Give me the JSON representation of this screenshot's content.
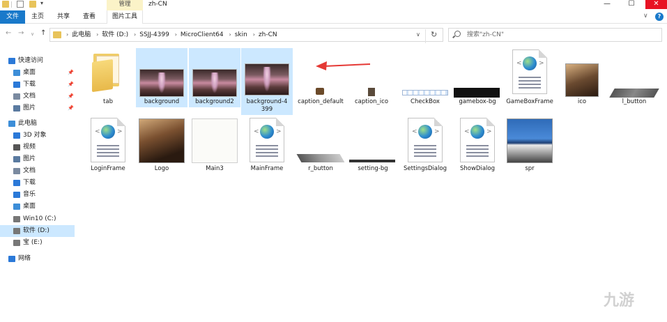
{
  "window": {
    "title": "zh-CN",
    "manage_tab": "管理",
    "minimize": "—",
    "maximize": "☐",
    "close": "✕"
  },
  "ribbon": {
    "tabs": [
      "文件",
      "主页",
      "共享",
      "查看",
      "图片工具"
    ],
    "expand": "∨",
    "help": "?"
  },
  "address": {
    "breadcrumbs": [
      "此电脑",
      "软件 (D:)",
      "SSJJ-4399",
      "MicroClient64",
      "skin",
      "zh-CN"
    ],
    "search_placeholder": "搜索\"zh-CN\""
  },
  "sidebar": {
    "items": [
      {
        "label": "快速访问",
        "icon": "star-icon",
        "color": "#2b79d8",
        "indent": 0
      },
      {
        "label": "桌面",
        "icon": "desktop-icon",
        "color": "#3d8ed8",
        "indent": 1,
        "pinned": true
      },
      {
        "label": "下载",
        "icon": "download-icon",
        "color": "#2b79d8",
        "indent": 1,
        "pinned": true
      },
      {
        "label": "文档",
        "icon": "documents-icon",
        "color": "#7a8aa0",
        "indent": 1,
        "pinned": true
      },
      {
        "label": "图片",
        "icon": "pictures-icon",
        "color": "#5a7aa0",
        "indent": 1,
        "pinned": true
      },
      {
        "label": "此电脑",
        "icon": "computer-icon",
        "color": "#3d8ed8",
        "indent": 0
      },
      {
        "label": "3D 对象",
        "icon": "3d-objects-icon",
        "color": "#2b79d8",
        "indent": 1
      },
      {
        "label": "视频",
        "icon": "videos-icon",
        "color": "#555",
        "indent": 1
      },
      {
        "label": "图片",
        "icon": "pictures-icon",
        "color": "#5a7aa0",
        "indent": 1
      },
      {
        "label": "文档",
        "icon": "documents-icon",
        "color": "#7a8aa0",
        "indent": 1
      },
      {
        "label": "下载",
        "icon": "download-icon",
        "color": "#2b79d8",
        "indent": 1
      },
      {
        "label": "音乐",
        "icon": "music-icon",
        "color": "#2b79d8",
        "indent": 1
      },
      {
        "label": "桌面",
        "icon": "desktop-icon",
        "color": "#3d8ed8",
        "indent": 1
      },
      {
        "label": "Win10 (C:)",
        "icon": "drive-icon",
        "color": "#777",
        "indent": 1
      },
      {
        "label": "软件 (D:)",
        "icon": "drive-icon",
        "color": "#777",
        "indent": 1,
        "selected": true
      },
      {
        "label": "宝 (E:)",
        "icon": "drive-icon",
        "color": "#777",
        "indent": 1
      },
      {
        "label": "网络",
        "icon": "network-icon",
        "color": "#2b79d8",
        "indent": 0
      }
    ]
  },
  "files": {
    "row1": [
      "tab",
      "background",
      "background2",
      "background-4399",
      "caption_default",
      "caption_ico",
      "CheckBox",
      "gamebox-bg",
      "GameBoxFrame",
      "ico",
      "l_button"
    ],
    "row2": [
      "LoginFrame",
      "Logo",
      "Main3",
      "MainFrame",
      "r_button",
      "setting-bg",
      "SettingsDialog",
      "ShowDialog",
      "spr"
    ]
  },
  "watermark": "九游",
  "colors": {
    "accent": "#1979ca",
    "selection": "#cce8ff",
    "arrow": "#e53935"
  }
}
